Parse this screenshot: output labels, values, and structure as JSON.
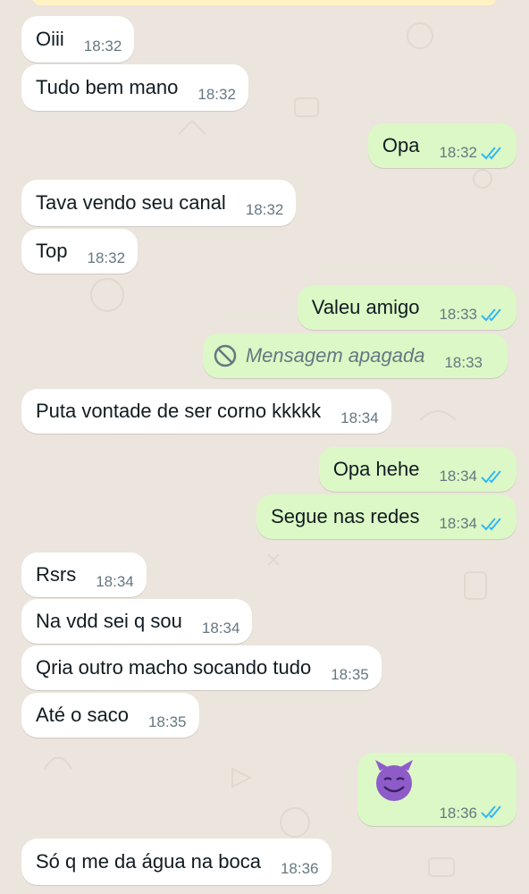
{
  "colors": {
    "background": "#ECE5DD",
    "incoming_bubble": "#FFFFFF",
    "outgoing_bubble": "#DCF8C6",
    "read_ticks": "#34B7F1",
    "timestamp": "#667781",
    "emoji": "#8E5CC9"
  },
  "messages": [
    {
      "dir": "in",
      "text": "Oiii",
      "time": "18:32"
    },
    {
      "dir": "in",
      "text": "Tudo bem mano",
      "time": "18:32"
    },
    {
      "dir": "out",
      "text": "Opa",
      "time": "18:32",
      "status": "read"
    },
    {
      "dir": "in",
      "text": "Tava vendo seu canal",
      "time": "18:32"
    },
    {
      "dir": "in",
      "text": "Top",
      "time": "18:32"
    },
    {
      "dir": "out",
      "text": "Valeu amigo",
      "time": "18:33",
      "status": "read"
    },
    {
      "dir": "out",
      "text": "Mensagem apagada",
      "time": "18:33",
      "deleted": true,
      "icon": "blocked-icon"
    },
    {
      "dir": "in",
      "text": "Puta vontade de ser corno kkkkk",
      "time": "18:34"
    },
    {
      "dir": "out",
      "text": "Opa hehe",
      "time": "18:34",
      "status": "read"
    },
    {
      "dir": "out",
      "text": "Segue nas redes",
      "time": "18:34",
      "status": "read"
    },
    {
      "dir": "in",
      "text": "Rsrs",
      "time": "18:34"
    },
    {
      "dir": "in",
      "text": "Na vdd sei q sou",
      "time": "18:34"
    },
    {
      "dir": "in",
      "text": "Qria outro macho socando tudo",
      "time": "18:35"
    },
    {
      "dir": "in",
      "text": "Até o saco",
      "time": "18:35"
    },
    {
      "dir": "out",
      "emoji": "smiling-devil-emoji",
      "time": "18:36",
      "status": "read"
    },
    {
      "dir": "in",
      "text": "Só q me da água na boca",
      "time": "18:36"
    }
  ]
}
